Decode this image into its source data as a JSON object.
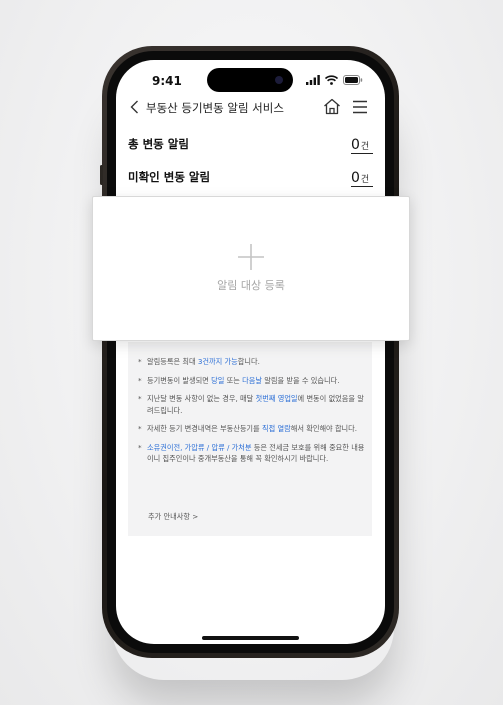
{
  "status_bar": {
    "time": "9:41"
  },
  "header": {
    "title": "부동산 등기변동 알림 서비스"
  },
  "counts": [
    {
      "label": "총 변동 알림",
      "value": "0",
      "unit": "건"
    },
    {
      "label": "미확인 변동 알림",
      "value": "0",
      "unit": "건"
    }
  ],
  "register": {
    "label": "알림 대상 등록"
  },
  "notes": [
    {
      "pre": "알림등록은 최대 ",
      "hl1": "3건까지 가능",
      "mid": "합니다.",
      "hl2": "",
      "post": ""
    },
    {
      "pre": "등기변동이 발생되면 ",
      "hl1": "당일",
      "mid": " 또는 ",
      "hl2": "다음날",
      "post": " 알림을 받을 수 있습니다."
    },
    {
      "pre": "지난달 변동 사항이 없는 경우, 매달 ",
      "hl1": "첫번째 영업일",
      "mid": "에 변동이 없었음을 알려드립니다.",
      "hl2": "",
      "post": ""
    },
    {
      "pre": "자세한 등기 변경내역은 부동산등기를 ",
      "hl1": "직접 열람",
      "mid": "해서 확인해야 합니다.",
      "hl2": "",
      "post": ""
    },
    {
      "pre": "",
      "hl1": "소유권이전, 가압류 / 압류 / 가처분",
      "mid": " 등은 전세금 보호를 위해 중요한 내용이니 집주인이나 중개부동산을 통해 꼭 확인하시기 바랍니다.",
      "hl2": "",
      "post": ""
    }
  ],
  "more_link": "추가 안내사항 >",
  "colors": {
    "highlight": "#2c6fd6",
    "text": "#111111",
    "muted": "#555555"
  }
}
